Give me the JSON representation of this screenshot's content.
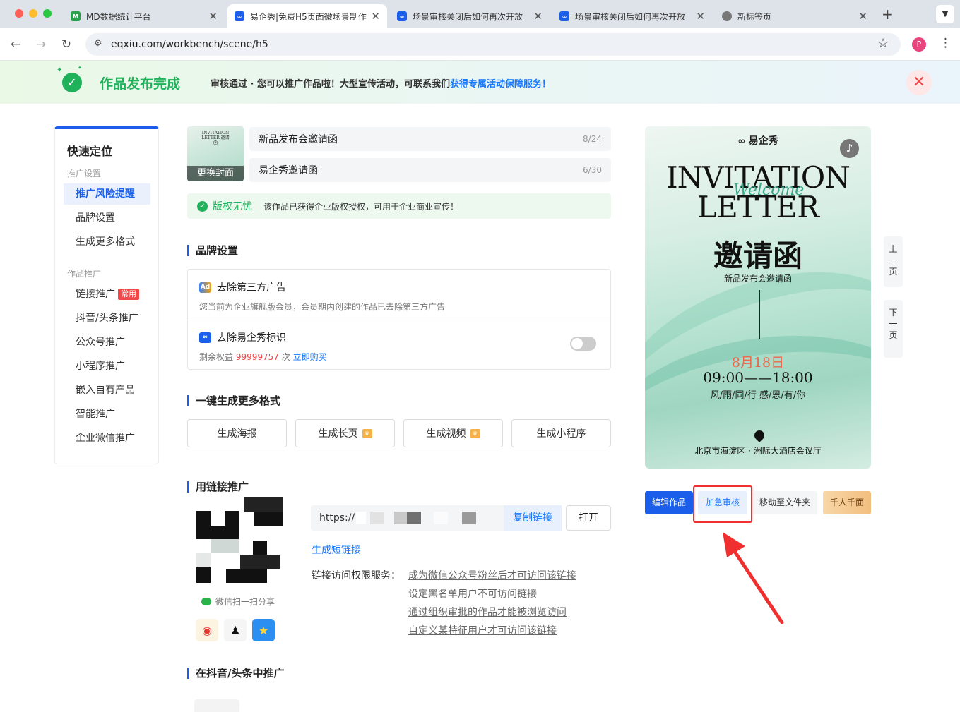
{
  "browser": {
    "tabs": [
      {
        "title": "MD数据统计平台",
        "active": false,
        "favicon_color": "#2aa04a"
      },
      {
        "title": "易企秀|免费H5页面微场景制作",
        "active": true,
        "favicon_color": "#1a5eea"
      },
      {
        "title": "场景审核关闭后如何再次开放",
        "active": false,
        "favicon_color": "#1a5eea"
      },
      {
        "title": "场景审核关闭后如何再次开放",
        "active": false,
        "favicon_color": "#1a5eea"
      },
      {
        "title": "新标签页",
        "active": false,
        "favicon_color": "#666666"
      }
    ],
    "url": "eqxiu.com/workbench/scene/h5",
    "profile_initial": "P"
  },
  "banner": {
    "title": "作品发布完成",
    "message": "审核通过 · 您可以推广作品啦！大型宣传活动，可联系我们",
    "link": "获得专属活动保障服务！"
  },
  "leftnav": {
    "heading": "快速定位",
    "group1": "推广设置",
    "group1_items": [
      "推广风险提醒",
      "品牌设置",
      "生成更多格式"
    ],
    "group2": "作品推广",
    "group2_items": [
      "链接推广",
      "抖音/头条推广",
      "公众号推广",
      "小程序推广",
      "嵌入自有产品",
      "智能推广",
      "企业微信推广"
    ],
    "hot_tag": "常用"
  },
  "cover": {
    "label": "更换封面",
    "mini_text": "INVITATION LETTER 邀请函"
  },
  "title_field": {
    "value": "新品发布会邀请函",
    "count": "8/24"
  },
  "desc_field": {
    "value": "易企秀邀请函",
    "count": "6/30"
  },
  "copyright": {
    "label": "版权无忧",
    "text": "该作品已获得企业版权授权，可用于企业商业宣传！"
  },
  "sections": {
    "brand": "品牌设置",
    "formats": "一键生成更多格式",
    "link": "用链接推广",
    "douyin": "在抖音/头条中推广"
  },
  "brand": {
    "row1_title": "去除第三方广告",
    "row1_desc": "您当前为企业旗舰版会员，会员期内创建的作品已去除第三方广告",
    "row2_title": "去除易企秀标识",
    "row2_desc_prefix": "剩余权益",
    "row2_count": "99999757",
    "row2_unit": "次",
    "row2_buy": "立即购买",
    "toggle_on": false
  },
  "formats": [
    "生成海报",
    "生成长页",
    "生成视频",
    "生成小程序"
  ],
  "link_promo": {
    "wechat_scan": "微信扫一扫分享",
    "url_prefix": "https://",
    "copy_label": "复制链接",
    "open_label": "打开",
    "short_link": "生成短链接",
    "perm_label": "链接访问权限服务：",
    "perm_items": [
      "成为微信公众号粉丝后才可访问该链接",
      "设定黑名单用户不可访问链接",
      "通过组织审批的作品才能被浏览访问",
      "自定义某特征用户才可访问该链接"
    ]
  },
  "preview": {
    "brand": "易企秀",
    "line1": "INVITATION",
    "line2": "LETTER",
    "welcome": "Welcome",
    "title": "邀请函",
    "subtitle": "新品发布会邀请函",
    "date": "8月18日",
    "time": "09:00——18:00",
    "words": "风/雨/同/行   感/恩/有/你",
    "address": "北京市海淀区 · 洲际大酒店会议厅"
  },
  "pager": {
    "prev": "上一页",
    "next": "下一页"
  },
  "actions": {
    "edit": "编辑作品",
    "urgent": "加急审核",
    "move": "移动至文件夹",
    "qianren": "千人千面"
  },
  "colors": {
    "primary": "#1a5eea",
    "success": "#1fb25a",
    "danger": "#f04848",
    "highlight": "#f03030"
  }
}
